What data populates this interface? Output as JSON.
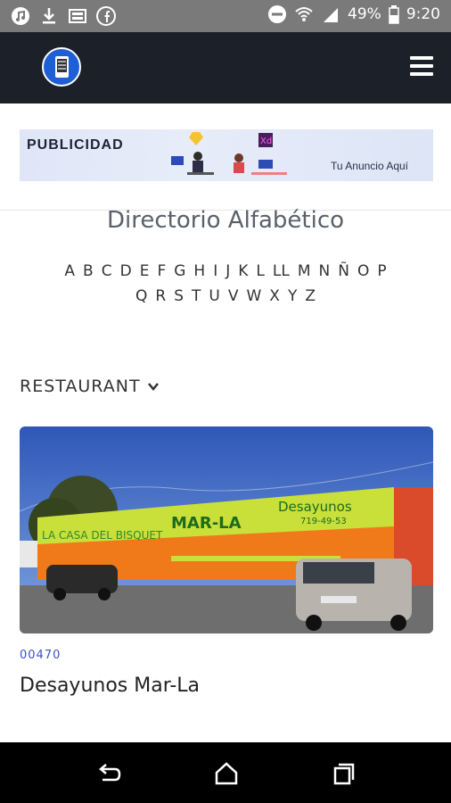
{
  "status_bar": {
    "battery": "49%",
    "time": "9:20"
  },
  "ad": {
    "title": "PUBLICIDAD",
    "subtitle": "Tu Anuncio Aquí",
    "badge": "Xd"
  },
  "directory": {
    "title": "Directorio Alfabético",
    "letters_row1": [
      "A",
      "B",
      "C",
      "D",
      "E",
      "F",
      "G",
      "H",
      "I",
      "J",
      "K",
      "L",
      "LL",
      "M",
      "N",
      "Ñ",
      "O",
      "P"
    ],
    "letters_row2": [
      "Q",
      "R",
      "S",
      "T",
      "U",
      "V",
      "W",
      "X",
      "Y",
      "Z"
    ]
  },
  "category": {
    "label": "RESTAURANT"
  },
  "listing": {
    "code": "00470",
    "name": "Desayunos Mar-La",
    "sign_left": "LA CASA DEL BISQUET",
    "sign_brand": "MAR-LA",
    "sign_right": "Desayunos",
    "sign_phone": "719-49-53"
  }
}
